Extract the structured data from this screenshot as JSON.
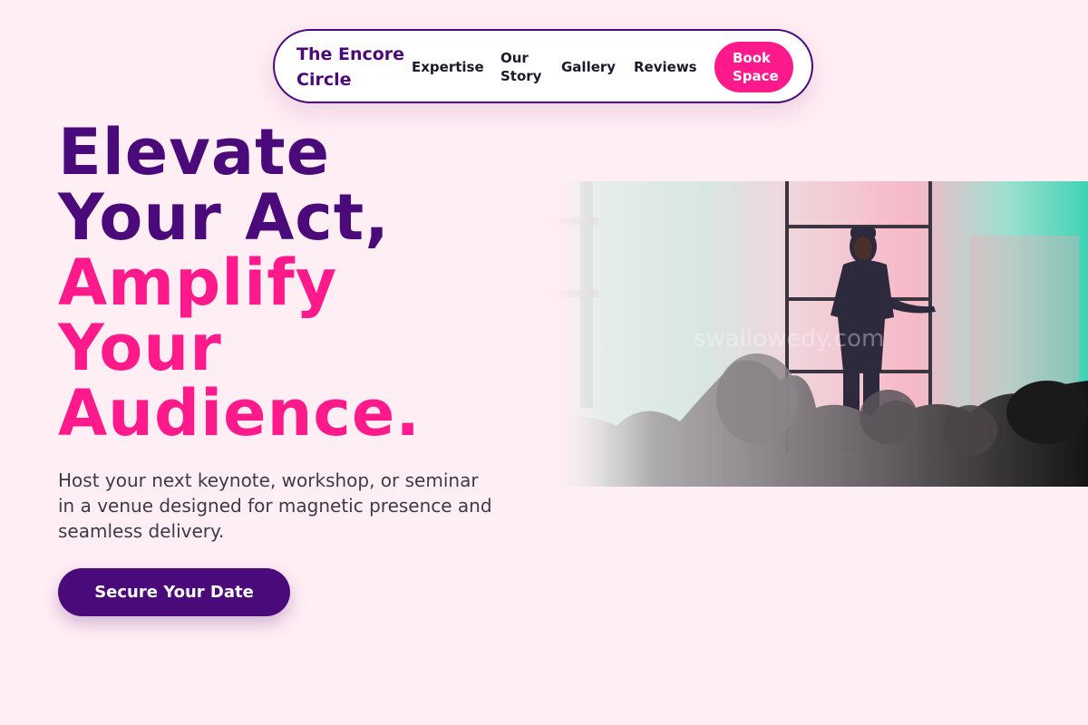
{
  "nav": {
    "brand": "The Encore Circle",
    "links": [
      {
        "label": "Expertise"
      },
      {
        "label": "Our Story"
      },
      {
        "label": "Gallery"
      },
      {
        "label": "Reviews"
      }
    ],
    "book_label": "Book Space"
  },
  "hero": {
    "headline_lines": [
      "Elevate",
      "Your Act,",
      "Amplify",
      "Your",
      "Audience."
    ],
    "subtext": "Host your next keynote, workshop, or seminar in a venue designed for magnetic presence and seamless delivery.",
    "cta_label": "Secure Your Date",
    "image_watermark": "swallowedy.com"
  },
  "colors": {
    "background": "#ffeef4",
    "primary_purple": "#4b0a7a",
    "accent_pink": "#ff1a8c"
  }
}
